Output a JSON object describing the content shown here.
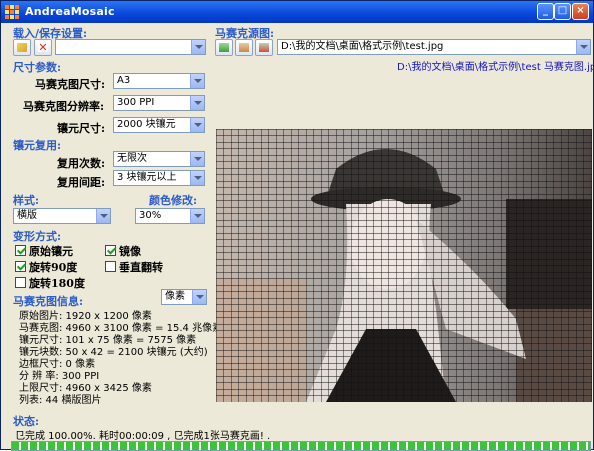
{
  "window": {
    "title": "AndreaMosaic"
  },
  "load_save": {
    "heading": "载入/保存设置:",
    "combo_value": ""
  },
  "source_image": {
    "heading": "马赛克源图:",
    "path": "D:\\我的文档\\桌面\\格式示例\\test.jpg",
    "output_path": "D:\\我的文档\\桌面\\格式示例\\test 马赛克图.jpg"
  },
  "size_params": {
    "heading": "尺寸参数:",
    "mosaic_size_label": "马赛克图尺寸:",
    "mosaic_size_value": "A3",
    "resolution_label": "马赛克图分辨率:",
    "resolution_value": "300 PPI",
    "tile_size_label": "镶元尺寸:",
    "tile_size_value": "2000 块镶元"
  },
  "tile_reuse": {
    "heading": "镶元复用:",
    "repeat_label": "复用次数:",
    "repeat_value": "无限次",
    "interval_label": "复用间距:",
    "interval_value": "3 块镶元以上"
  },
  "style": {
    "heading": "样式:",
    "value": "横版",
    "color_heading": "颜色修改:",
    "color_value": "30%"
  },
  "transform": {
    "heading": "变形方式:",
    "options": [
      {
        "label": "原始镶元",
        "checked": true
      },
      {
        "label": "镜像",
        "checked": true
      },
      {
        "label": "旋转90度",
        "checked": true
      },
      {
        "label": "垂直翻转",
        "checked": false
      },
      {
        "label": "旋转180度",
        "checked": false
      }
    ]
  },
  "mosaic_info": {
    "heading": "马赛克图信息:",
    "unit_value": "像素",
    "lines": [
      "原始图片: 1920 x 1200 像素",
      "马赛克图: 4960 x 3100 像素 = 15.4 兆像素",
      "镶元尺寸: 101 x 75 像素 = 7575 像素",
      "镶元块数: 50 x 42 = 2100 块镶元 (大约)",
      "边框尺寸: 0 像素",
      "分 辨 率: 300 PPI",
      "上限尺寸: 4960 x 3425 像素",
      "列表:  44 横版图片"
    ]
  },
  "status": {
    "heading": "状态:",
    "text": "㔾完成 100.00%.  耗时00:00:09 , 㔾完成1张马赛克画! .",
    "progress": 1.0
  },
  "colors": {
    "section_heading": "#2c5cc8",
    "progress": "#3cc33c",
    "link": "#1414c8"
  }
}
